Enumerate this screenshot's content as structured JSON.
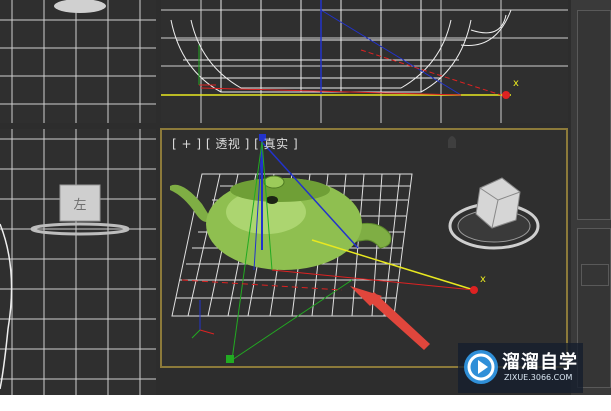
{
  "viewport_perspective": {
    "label": "[ + ] [ 透视 ] [ 真实 ]",
    "axis_label_x": "x"
  },
  "viewport_top_right": {
    "axis_label_x": "x"
  },
  "viewport_left": {
    "viewcube_face": "左"
  },
  "watermark": {
    "name": "溜溜自学",
    "url": "ZIXUE.3066.COM"
  },
  "colors": {
    "viewport_background": "#2f2f2f",
    "active_viewport_border": "#8c7a3a",
    "grid": "#d8d8d8",
    "teapot": "#8fbf50",
    "annotation_arrow": "#e0463c",
    "axis_x": "#e8e820",
    "axis_red": "#d22",
    "axis_green": "#2a2",
    "axis_blue": "#2233cc"
  }
}
